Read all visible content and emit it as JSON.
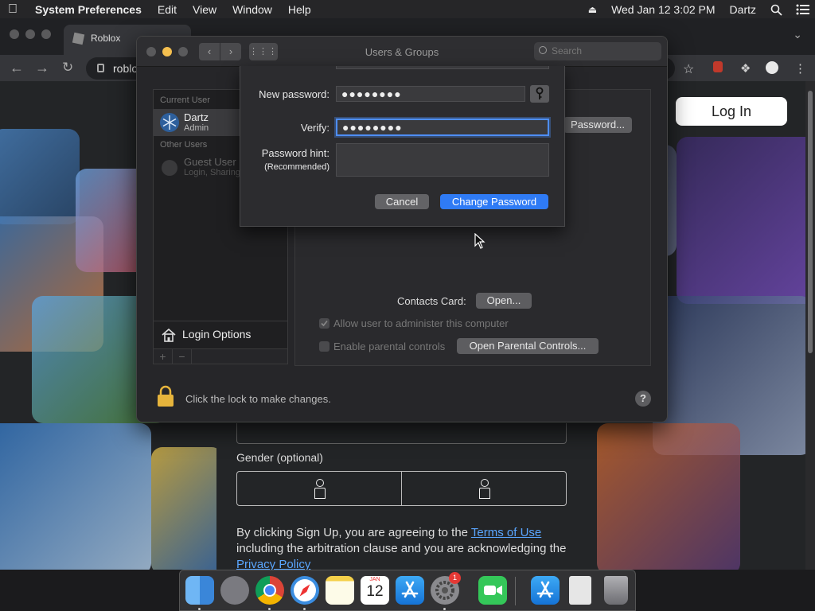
{
  "menubar": {
    "app": "System Preferences",
    "items": [
      "Edit",
      "View",
      "Window",
      "Help"
    ],
    "clock": "Wed Jan 12  3:02 PM",
    "user": "Dartz"
  },
  "browser": {
    "tab_title": "Roblox",
    "url": "roblo",
    "login_label": "Log In",
    "gender_label": "Gender (optional)",
    "legal_pre": "By clicking Sign Up, you are agreeing to the ",
    "legal_terms": "Terms of Use",
    "legal_mid": " including the arbitration clause and you are acknowledging the ",
    "legal_privacy": "Privacy Policy"
  },
  "prefs": {
    "title": "Users & Groups",
    "search_placeholder": "Search",
    "current_user_header": "Current User",
    "current_user_name": "Dartz",
    "current_user_role": "Admin",
    "other_users_header": "Other Users",
    "guest_name": "Guest User",
    "guest_role": "Login, Sharing",
    "login_options": "Login Options",
    "change_password_btn": "Password...",
    "contacts_card_label": "Contacts Card:",
    "open_btn": "Open...",
    "allow_admin": "Allow user to administer this computer",
    "parental_controls": "Enable parental controls",
    "open_parental_btn": "Open Parental Controls...",
    "lock_text": "Click the lock to make changes.",
    "help": "?"
  },
  "sheet": {
    "new_password_label": "New password:",
    "new_password_value": "●●●●●●●●",
    "verify_label": "Verify:",
    "verify_value": "●●●●●●●●",
    "hint_label": "Password hint:",
    "hint_sub": "(Recommended)",
    "hint_value": "",
    "cancel": "Cancel",
    "change": "Change Password"
  },
  "dock": {
    "calendar_month": "JAN",
    "calendar_day": "12",
    "badge": "1"
  },
  "colors": {
    "accent": "#2f7bf5",
    "focus_ring": "#4e8ef7",
    "lock": "#e6b43c",
    "link": "#5aa6ff"
  }
}
